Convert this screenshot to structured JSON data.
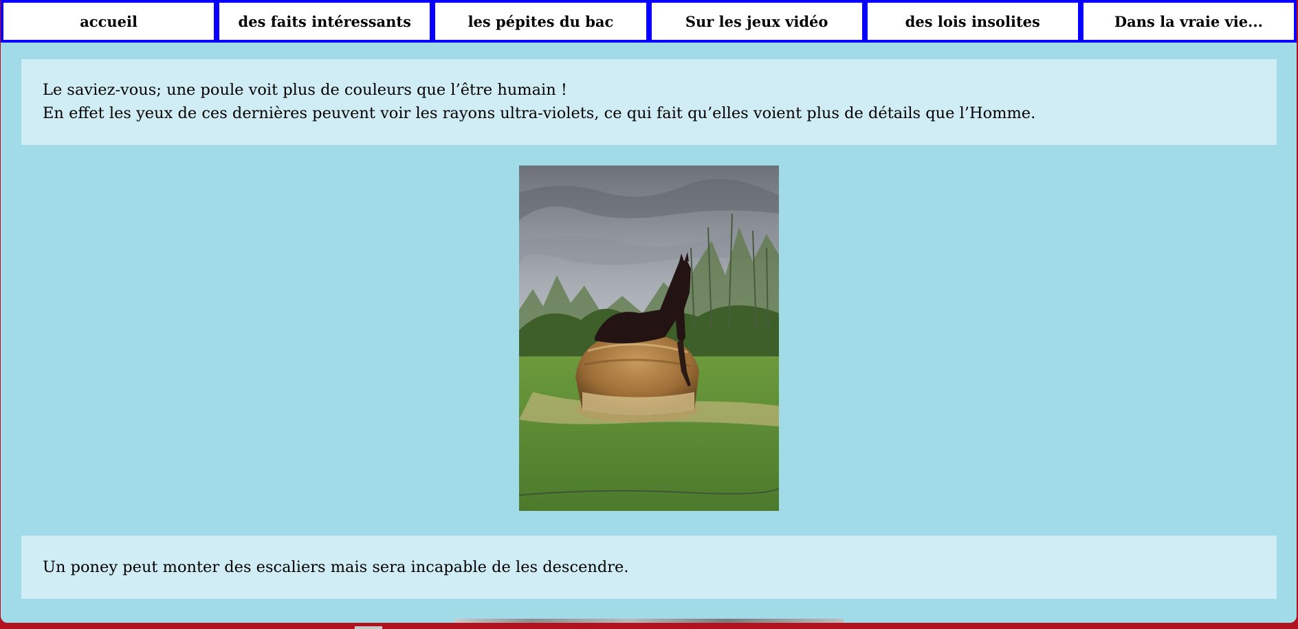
{
  "nav": {
    "items": [
      {
        "label": "accueil"
      },
      {
        "label": "des faits intéressants"
      },
      {
        "label": "les pépites du bac"
      },
      {
        "label": "Sur les jeux vidéo"
      },
      {
        "label": "des lois insolites"
      },
      {
        "label": "Dans la vraie vie..."
      }
    ]
  },
  "facts": [
    {
      "line1": "Le saviez-vous; une poule voit plus de couleurs que l’être humain !",
      "line2": "En effet les yeux de ces dernières peuvent voir les rayons ultra-violets, ce qui fait qu’elles voient plus de détails que l’Homme."
    },
    {
      "line1": "Un poney peut monter des escaliers mais sera incapable de les descendre."
    }
  ],
  "colors": {
    "page_background": "#a1dbe8",
    "card_background": "#d0edf5",
    "nav_border": "#0a00ff",
    "window_edge": "#b1121e"
  },
  "images": [
    {
      "icon": "horse-on-haybale-photo"
    },
    {
      "icon": "partial-photo"
    }
  ]
}
